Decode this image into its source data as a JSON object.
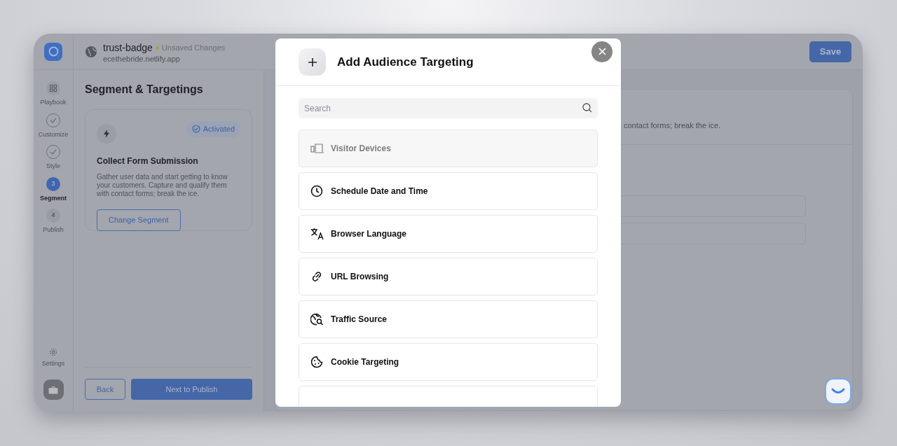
{
  "header": {
    "title": "trust-badge",
    "status": "Unsaved Changes",
    "url": "ecethebride.netlify.app",
    "save": "Save"
  },
  "steps": [
    {
      "label": "Playbook",
      "kind": "icon",
      "selected": false
    },
    {
      "label": "Customize",
      "kind": "done",
      "selected": false
    },
    {
      "label": "Style",
      "kind": "done",
      "selected": false
    },
    {
      "label": "Segment",
      "kind": "number",
      "number": "3",
      "selected": true
    },
    {
      "label": "Publish",
      "kind": "number",
      "number": "4",
      "selected": false
    }
  ],
  "settings": "Settings",
  "panel": {
    "title": "Segment & Targetings",
    "card": {
      "badge": "Activated",
      "title": "Collect Form Submission",
      "text": "Gather user data and start getting to know your customers. Capture and qualify them with contact forms; break the ice.",
      "button": "Change Segment"
    },
    "back": "Back",
    "next": "Next to Publish"
  },
  "background": {
    "text": "contact forms; break the ice."
  },
  "modal": {
    "title": "Add Audience Targeting",
    "search": {
      "placeholder": "Search"
    },
    "options": [
      {
        "label": "Visitor Devices",
        "kind": "devices",
        "disabled": true
      },
      {
        "label": "Schedule Date and Time",
        "kind": "clock",
        "disabled": false
      },
      {
        "label": "Browser Language",
        "kind": "translate",
        "disabled": false
      },
      {
        "label": "URL Browsing",
        "kind": "link",
        "disabled": false
      },
      {
        "label": "Traffic Source",
        "kind": "globe-search",
        "disabled": false
      },
      {
        "label": "Cookie Targeting",
        "kind": "cookie",
        "disabled": false
      }
    ]
  }
}
